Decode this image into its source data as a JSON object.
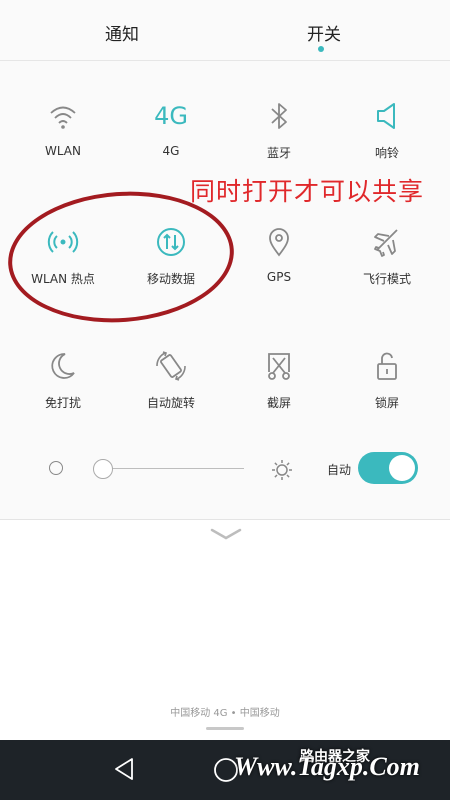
{
  "tabs": [
    {
      "label": "通知",
      "active": false
    },
    {
      "label": "开关",
      "active": true
    }
  ],
  "tiles": [
    {
      "label": "WLAN",
      "icon": "wifi-icon",
      "active": false
    },
    {
      "label": "4G",
      "icon": "4g-icon",
      "active": true
    },
    {
      "label": "蓝牙",
      "icon": "bluetooth-icon",
      "active": false
    },
    {
      "label": "响铃",
      "icon": "ring-icon",
      "active": true
    },
    {
      "label": "WLAN 热点",
      "icon": "hotspot-icon",
      "active": true
    },
    {
      "label": "移动数据",
      "icon": "mobile-data-icon",
      "active": true
    },
    {
      "label": "GPS",
      "icon": "gps-icon",
      "active": false
    },
    {
      "label": "飞行模式",
      "icon": "airplane-icon",
      "active": false
    },
    {
      "label": "免打扰",
      "icon": "moon-icon",
      "active": false
    },
    {
      "label": "自动旋转",
      "icon": "rotate-icon",
      "active": false
    },
    {
      "label": "截屏",
      "icon": "screenshot-icon",
      "active": false
    },
    {
      "label": "锁屏",
      "icon": "lock-icon",
      "active": false
    }
  ],
  "icon_4g_text": "4G",
  "annotation": "同时打开才可以共享",
  "brightness": {
    "level": 0.0,
    "auto_label": "自动",
    "auto_on": true
  },
  "carrier": "中国移动 4G • 中国移动",
  "watermark": {
    "main": "Www.Tagxp.Com",
    "sub": "路由器之家"
  },
  "colors": {
    "accent": "#3bb9be",
    "icon_gray": "#888888",
    "annotation": "#e0282b",
    "ellipse": "#a31b20"
  }
}
